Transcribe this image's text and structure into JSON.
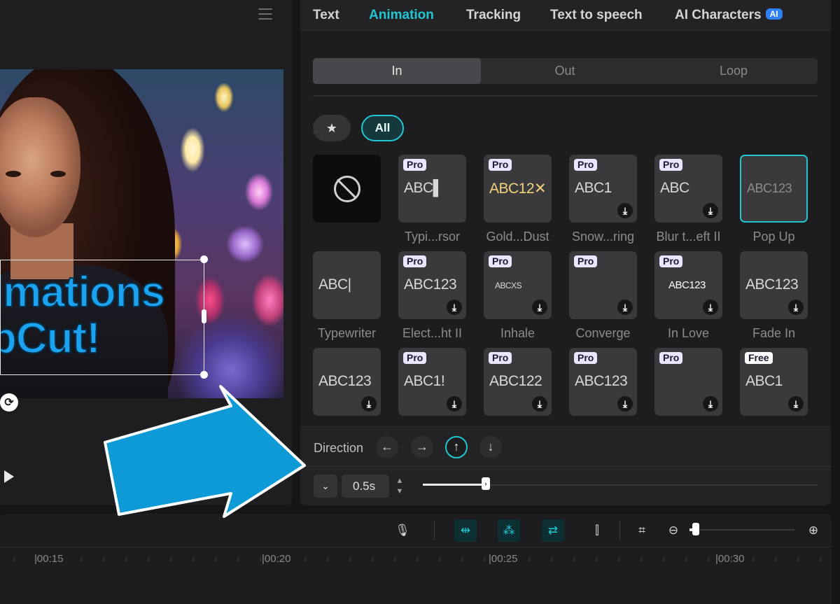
{
  "player": {
    "overlay_line1": "imations",
    "overlay_line2": "pCut!"
  },
  "tabs": [
    {
      "label": "Text"
    },
    {
      "label": "Animation"
    },
    {
      "label": "Tracking"
    },
    {
      "label": "Text to speech"
    },
    {
      "label": "AI Characters",
      "badge": "AI"
    }
  ],
  "segments": [
    {
      "label": "In"
    },
    {
      "label": "Out"
    },
    {
      "label": "Loop"
    }
  ],
  "filters": {
    "all_label": "All"
  },
  "animations": [
    {
      "name": "",
      "thumb_text": "",
      "tag": ""
    },
    {
      "name": "Typi...rsor",
      "thumb_text": "ABC▌",
      "tag": "Pro"
    },
    {
      "name": "Gold...Dust",
      "thumb_text": "ABC12✕",
      "tag": "Pro"
    },
    {
      "name": "Snow...ring",
      "thumb_text": "ABC1",
      "tag": "Pro"
    },
    {
      "name": "Blur t...eft II",
      "thumb_text": "ABC",
      "tag": "Pro"
    },
    {
      "name": "Pop Up",
      "thumb_text": "ABC123",
      "tag": ""
    },
    {
      "name": "Typewriter",
      "thumb_text": "ABC|",
      "tag": ""
    },
    {
      "name": "Elect...ht II",
      "thumb_text": "ABC123",
      "tag": "Pro"
    },
    {
      "name": "Inhale",
      "thumb_text": "ABCXS",
      "tag": "Pro"
    },
    {
      "name": "Converge",
      "thumb_text": "",
      "tag": "Pro"
    },
    {
      "name": "In Love",
      "thumb_text": "ABC123",
      "tag": "Pro"
    },
    {
      "name": "Fade In",
      "thumb_text": "ABC123",
      "tag": ""
    },
    {
      "name": "",
      "thumb_text": "ABC123",
      "tag": ""
    },
    {
      "name": "",
      "thumb_text": "ABC1!",
      "tag": "Pro"
    },
    {
      "name": "",
      "thumb_text": "ABC122",
      "tag": "Pro"
    },
    {
      "name": "",
      "thumb_text": "ABC123",
      "tag": "Pro"
    },
    {
      "name": "",
      "thumb_text": "",
      "tag": "Pro"
    },
    {
      "name": "",
      "thumb_text": "ABC1",
      "tag": "Free"
    }
  ],
  "direction": {
    "label": "Direction",
    "options": [
      "←",
      "→",
      "↑",
      "↓"
    ],
    "selected": "↑"
  },
  "duration": {
    "value": "0.5s",
    "slider_fraction": 0.16
  },
  "timeline": {
    "ticks": [
      "|00:15",
      "|00:20",
      "|00:25",
      "|00:30"
    ],
    "zoom_fraction": 0.06
  },
  "colors": {
    "accent": "#22c5d2",
    "arrow": "#0e9ad6"
  }
}
